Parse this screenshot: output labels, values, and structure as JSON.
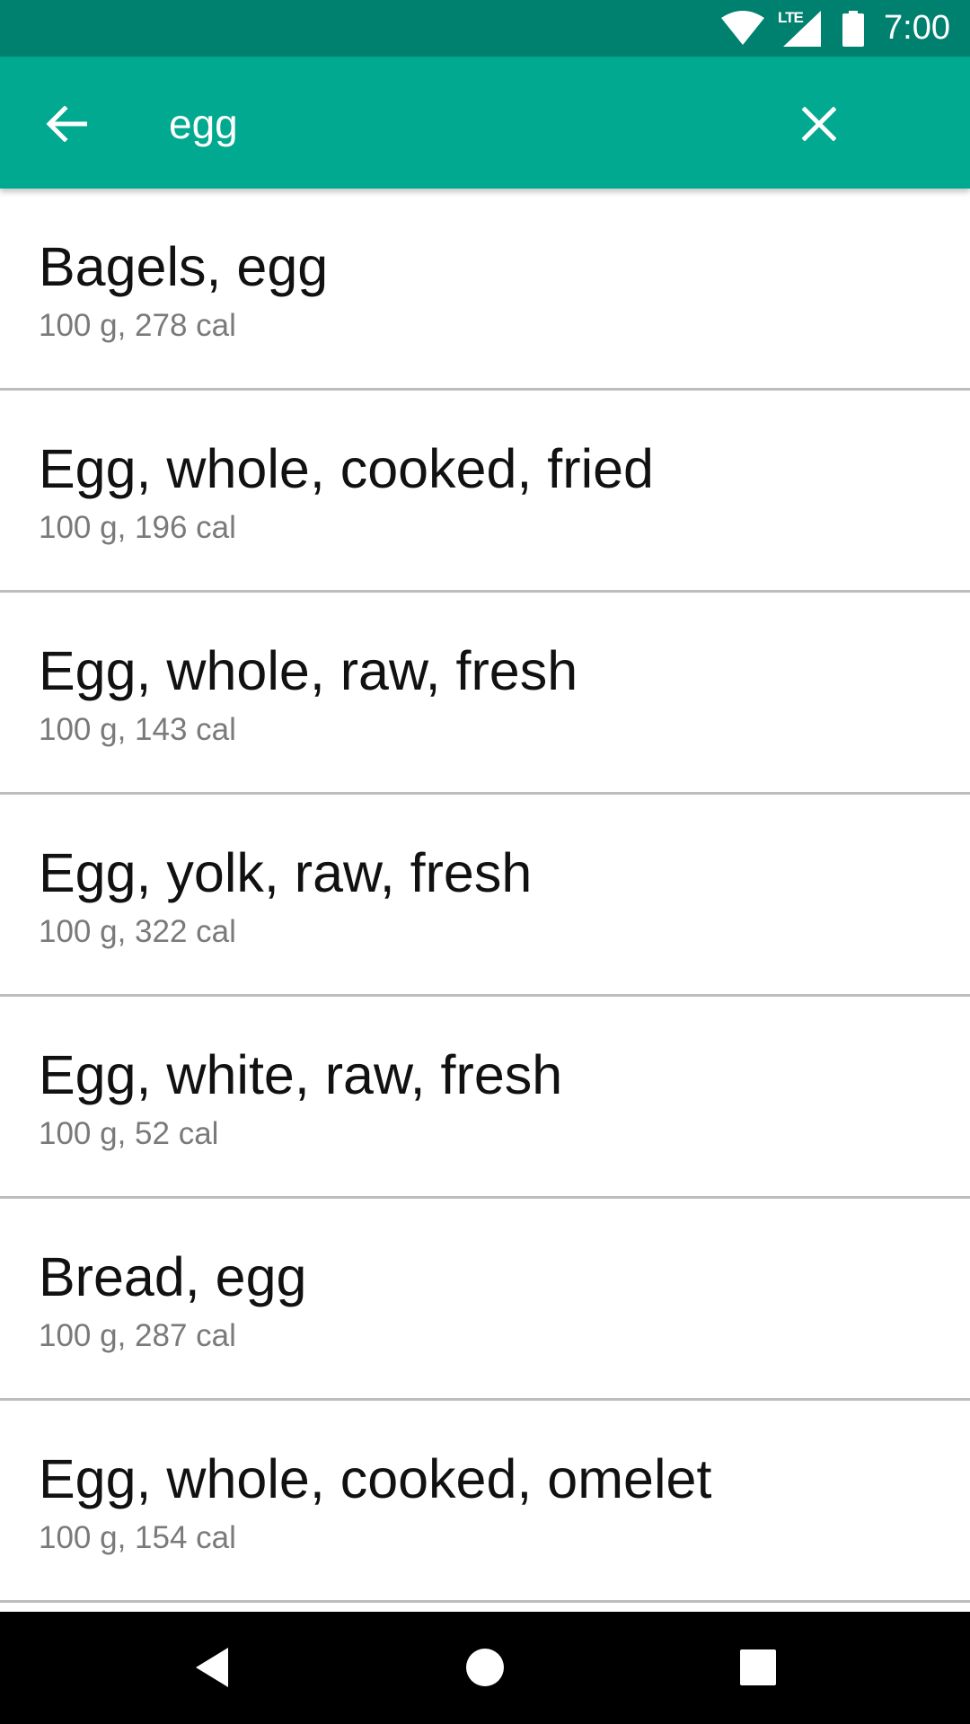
{
  "status_bar": {
    "time": "7:00",
    "network_label": "LTE",
    "icons": [
      "wifi-icon",
      "lte-signal-icon",
      "battery-icon"
    ]
  },
  "search": {
    "query": "egg",
    "back_icon": "arrow-back-icon",
    "clear_icon": "close-icon"
  },
  "results": [
    {
      "title": "Bagels, egg",
      "detail": "100 g, 278 cal"
    },
    {
      "title": "Egg, whole, cooked, fried",
      "detail": "100 g, 196 cal"
    },
    {
      "title": "Egg, whole, raw, fresh",
      "detail": "100 g, 143 cal"
    },
    {
      "title": "Egg, yolk, raw, fresh",
      "detail": "100 g, 322 cal"
    },
    {
      "title": "Egg, white, raw, fresh",
      "detail": "100 g, 52 cal"
    },
    {
      "title": "Bread, egg",
      "detail": "100 g, 287 cal"
    },
    {
      "title": "Egg, whole, cooked, omelet",
      "detail": "100 g, 154 cal"
    }
  ],
  "nav_bar": {
    "icons": [
      "nav-back-icon",
      "nav-home-icon",
      "nav-recents-icon"
    ]
  },
  "colors": {
    "status_bar": "#00806e",
    "toolbar": "#00a98f",
    "divider": "#bdbdbd",
    "title_text": "#111111",
    "subtitle_text": "#7a7a7a",
    "nav_bar": "#000000"
  }
}
